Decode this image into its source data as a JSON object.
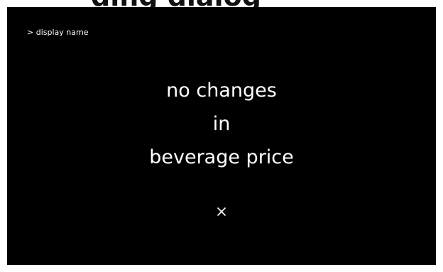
{
  "header_fragment": "ding  dialog",
  "breadcrumb": "> display name",
  "message": {
    "line1": "no changes",
    "line2": "in",
    "line3": "beverage price"
  },
  "close": {
    "icon": "close-icon",
    "label": "×"
  },
  "colors": {
    "screen_background": "#000000",
    "text": "#ffffff",
    "page_background": "#ffffff"
  }
}
